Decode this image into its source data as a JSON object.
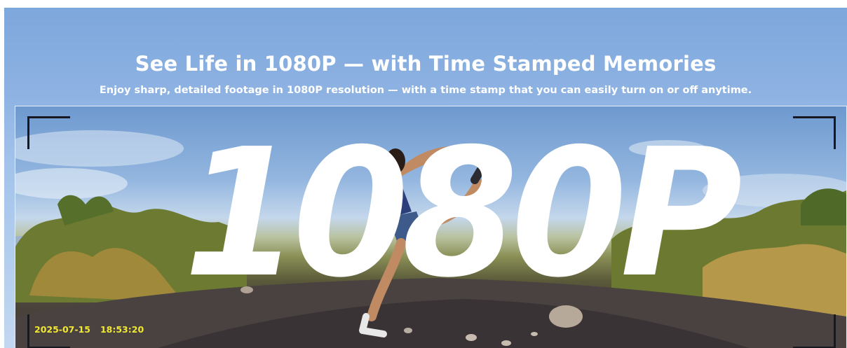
{
  "hero": {
    "headline": "See Life in 1080P — with Time Stamped Memories",
    "subline": "Enjoy sharp, detailed footage in 1080P resolution — with a time stamp that you can easily turn on or off anytime."
  },
  "photo": {
    "overlay_text": "1080P",
    "timestamp": {
      "date": "2025-07-15",
      "time": "18:53:20"
    }
  },
  "colors": {
    "sky_top": "#7ea7dc",
    "overlay_text": "#ffffff",
    "timestamp": "#f0e832",
    "corner_marks": "#16191f"
  }
}
